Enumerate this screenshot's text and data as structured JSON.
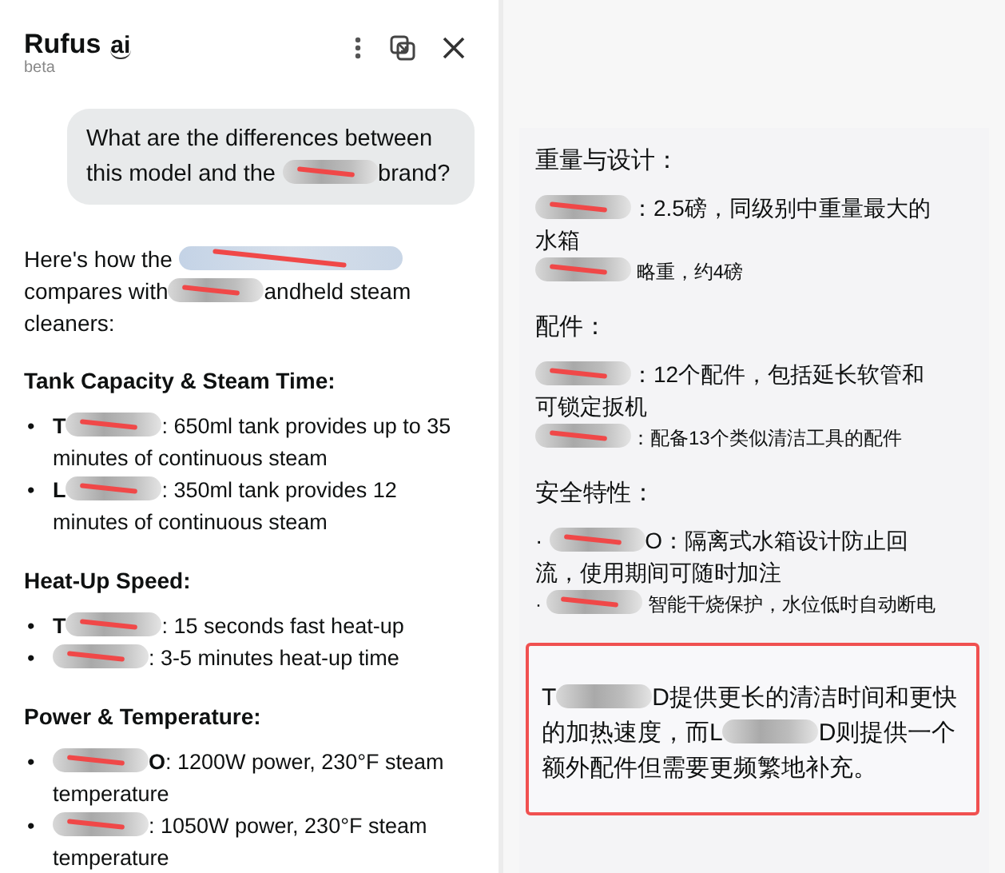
{
  "header": {
    "title": "Rufus",
    "badge": "ai",
    "subtitle": "beta"
  },
  "question": {
    "parts": [
      {
        "kind": "text",
        "text": "What are the differences between this model and the "
      },
      {
        "kind": "redacted"
      },
      {
        "kind": "text",
        "text": "brand?"
      }
    ]
  },
  "answer": {
    "intro": [
      {
        "kind": "text",
        "text": "Here's how the "
      },
      {
        "kind": "redacted"
      },
      {
        "kind": "text",
        "text": " compares with"
      },
      {
        "kind": "redacted"
      },
      {
        "kind": "text",
        "text": "andheld steam cleaners:"
      }
    ],
    "sections": [
      {
        "heading": "Tank Capacity & Steam Time:",
        "items": [
          {
            "bullet": "•",
            "parts": [
              {
                "kind": "bold",
                "text": "T"
              },
              {
                "kind": "redacted"
              },
              {
                "kind": "text",
                "text": ": 650ml tank provides up to 35 minutes of continuous steam"
              }
            ]
          },
          {
            "bullet": "•",
            "parts": [
              {
                "kind": "bold",
                "text": "L"
              },
              {
                "kind": "redacted"
              },
              {
                "kind": "text",
                "text": ": 350ml tank provides 12 minutes of continuous steam"
              }
            ]
          }
        ]
      },
      {
        "heading": "Heat-Up Speed:",
        "items": [
          {
            "bullet": "•",
            "parts": [
              {
                "kind": "bold",
                "text": "T"
              },
              {
                "kind": "redacted"
              },
              {
                "kind": "text",
                "text": ": 15 seconds fast heat-up"
              }
            ]
          },
          {
            "bullet": "•",
            "parts": [
              {
                "kind": "redacted"
              },
              {
                "kind": "text",
                "text": ": 3-5 minutes heat-up time"
              }
            ]
          }
        ]
      },
      {
        "heading": "Power & Temperature:",
        "items": [
          {
            "bullet": "•",
            "parts": [
              {
                "kind": "redacted"
              },
              {
                "kind": "bold",
                "text": "O"
              },
              {
                "kind": "text",
                "text": ": 1200W power, 230°F steam temperature"
              }
            ]
          },
          {
            "bullet": "•",
            "parts": [
              {
                "kind": "redacted"
              },
              {
                "kind": "text",
                "text": ": 1050W power, 230°F steam temperature"
              }
            ]
          }
        ]
      }
    ]
  },
  "translation": {
    "sections": [
      {
        "heading": "重量与设计：",
        "items": [
          {
            "small": false,
            "parts": [
              {
                "kind": "redacted"
              },
              {
                "kind": "text",
                "text": "：2.5磅，同级别中重量最大的水箱"
              }
            ]
          },
          {
            "small": true,
            "parts": [
              {
                "kind": "redacted"
              },
              {
                "kind": "text",
                "text": " 略重，约4磅"
              }
            ]
          }
        ]
      },
      {
        "heading": "配件：",
        "items": [
          {
            "small": false,
            "parts": [
              {
                "kind": "redacted"
              },
              {
                "kind": "text",
                "text": "：12个配件，包括延长软管和可锁定扳机"
              }
            ]
          },
          {
            "small": true,
            "parts": [
              {
                "kind": "redacted"
              },
              {
                "kind": "text",
                "text": "：配备13个类似清洁工具的配件"
              }
            ]
          }
        ]
      },
      {
        "heading": "安全特性：",
        "items": [
          {
            "small": false,
            "parts": [
              {
                "kind": "text",
                "text": "· "
              },
              {
                "kind": "redacted"
              },
              {
                "kind": "text",
                "text": "O：隔离式水箱设计防止回流，使用期间可随时加注"
              }
            ]
          },
          {
            "small": true,
            "parts": [
              {
                "kind": "text",
                "text": "· "
              },
              {
                "kind": "redacted"
              },
              {
                "kind": "text",
                "text": " 智能干烧保护，水位低时自动断电"
              }
            ]
          }
        ]
      }
    ],
    "summary": [
      {
        "kind": "text",
        "text": "T"
      },
      {
        "kind": "redacted"
      },
      {
        "kind": "text",
        "text": "D提供更长的清洁时间和更快的加热速度，而L"
      },
      {
        "kind": "redacted"
      },
      {
        "kind": "text",
        "text": "D则提供一个额外配件但需要更频繁地补充。"
      }
    ]
  }
}
